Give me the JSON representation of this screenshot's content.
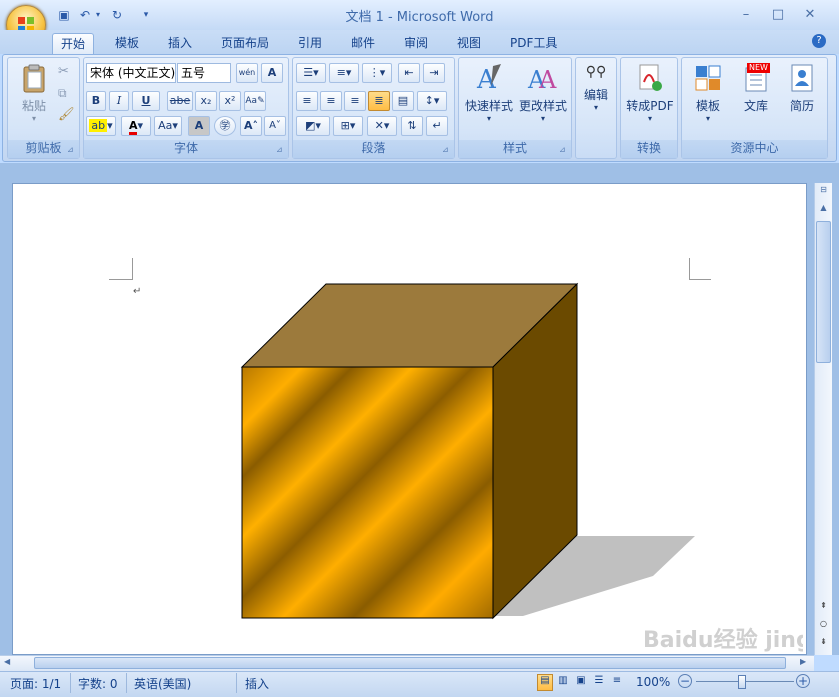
{
  "window": {
    "title": "文档 1 - Microsoft Word"
  },
  "tabs": [
    "开始",
    "模板",
    "插入",
    "页面布局",
    "引用",
    "邮件",
    "审阅",
    "视图",
    "PDF工具"
  ],
  "clipboard": {
    "paste": "粘贴",
    "group": "剪贴板"
  },
  "font": {
    "name": "宋体 (中文正文)",
    "size": "五号",
    "group": "字体",
    "bold": "B",
    "italic": "I",
    "underline": "U",
    "strike": "abe",
    "sub": "x₂",
    "sup": "x²",
    "case": "Aa",
    "grow": "A",
    "shrink": "A",
    "wen": "wén",
    "charborder": "A"
  },
  "paragraph": {
    "group": "段落"
  },
  "styles": {
    "quick": "快速样式",
    "change": "更改样式",
    "group": "样式"
  },
  "editing": {
    "label": "编辑"
  },
  "convert": {
    "pdf": "转成PDF",
    "group": "转换"
  },
  "resources": {
    "template": "模板",
    "library": "文库",
    "resume": "简历",
    "group": "资源中心",
    "badge": "NEW"
  },
  "document": {
    "para_mark": "↵"
  },
  "status": {
    "page": "页面: 1/1",
    "words": "字数: 0",
    "lang": "英语(美国)",
    "mode": "插入",
    "zoom": "100%"
  },
  "colors": {
    "accent": "#15428b",
    "cube_front_light": "#ffae00",
    "cube_top": "#9c7a3c",
    "cube_side": "#6b4a00",
    "shadow": "#c0c0c0"
  },
  "watermark": "Baidu经验 jingyan.baidu.com"
}
